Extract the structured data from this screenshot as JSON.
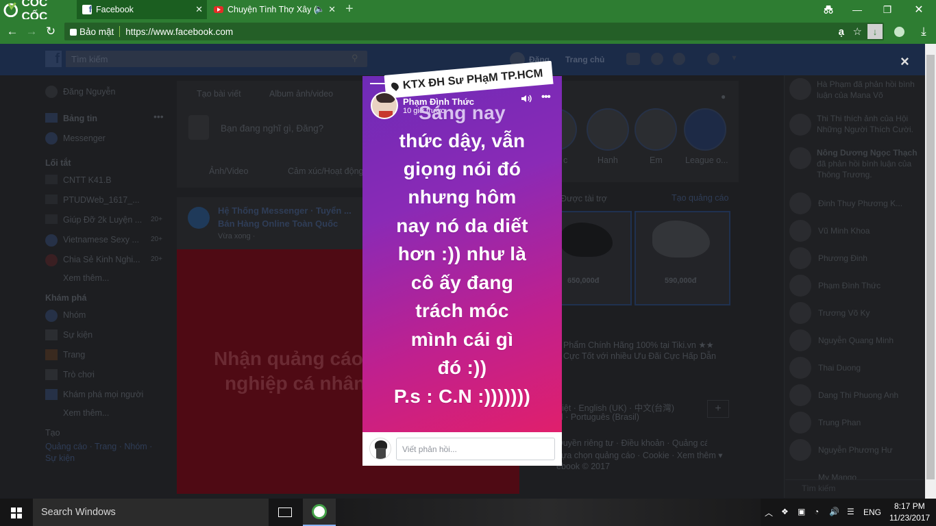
{
  "browser": {
    "brand": "CỐC CỐC",
    "tabs": [
      {
        "title": "Facebook",
        "close": "✕"
      },
      {
        "title": "Chuyện Tình Thợ Xây (",
        "close": "✕"
      }
    ],
    "new_tab": "+",
    "security_label": "Bảo mật",
    "url": "https://www.facebook.com",
    "lang_glyph": "ạ"
  },
  "facebook": {
    "search_placeholder": "Tìm kiếm",
    "header_user": "Đăng",
    "header_home": "Trang chủ",
    "sidebar": {
      "profile": "Đăng Nguyễn",
      "news_feed": "Bảng tin",
      "messenger": "Messenger",
      "shortcuts_heading": "Lối tắt",
      "shortcuts": [
        {
          "label": "CNTT K41.B",
          "count": ""
        },
        {
          "label": "PTUDWeb_1617_...",
          "count": ""
        },
        {
          "label": "Giúp Đỡ 2k Luyện ...",
          "count": "20+"
        },
        {
          "label": "Vietnamese Sexy ...",
          "count": "20+"
        },
        {
          "label": "Chia Sẻ Kinh Nghi...",
          "count": "20+"
        }
      ],
      "see_more": "Xem thêm...",
      "explore_heading": "Khám phá",
      "explore": [
        "Nhóm",
        "Sự kiện",
        "Trang",
        "Trò chơi",
        "Khám phá mọi người"
      ],
      "see_more2": "Xem thêm...",
      "create_heading": "Tạo",
      "create_links": "Quảng cáo · Trang · Nhóm ·",
      "create_links2": "Sự kiện"
    },
    "composer": {
      "create_post": "Tạo bài viết",
      "album": "Album ảnh/video",
      "placeholder": "Bạn đang nghĩ gì, Đăng?",
      "photo_video": "Ảnh/Video",
      "feeling": "Cảm xúc/Hoạt động"
    },
    "post": {
      "author_line1": "Hệ Thống Messenger · Tuyển ...",
      "author_line2": "Bán Hàng Online Toàn Quốc",
      "time": "Vừa xong ·",
      "ad_text_line1": "Nhận quảng cáo",
      "ad_text_line2": "nghiệp cá nhân"
    },
    "stories": [
      {
        "name": "c"
      },
      {
        "name": "Hanh"
      },
      {
        "name": "Em"
      },
      {
        "name": "League o..."
      }
    ],
    "sponsored": {
      "heading": "Được tài trợ",
      "create_ad": "Tạo quảng cáo",
      "prices": [
        "650,000đ",
        "590,000đ"
      ],
      "ad_desc_line1": "Phẩm Chính Hãng 100% tại Tiki.vn ★★",
      "ad_desc_line2": "Cực Tốt với nhiều Ưu Đãi Cực Hấp Dẫn"
    },
    "languages_line1": "Việt · English (UK) · 中文(台灣)",
    "languages_line2": "ol · Português (Brasil)",
    "footer_line1": "Quyền riêng tư · Điều khoản · Quảng cáo",
    "footer_line2": "Lựa chọn quảng cáo · Cookie · Xem thêm ▾",
    "footer_line3": "ebook © 2017",
    "chat": {
      "activity": [
        {
          "line1": "Hà Phạm đã phản hồi bình",
          "line2": "luận của Mana Võ"
        },
        {
          "line1": "Thi Thi thích ảnh của Hội",
          "line2": "Những Người Thích Cười."
        },
        {
          "line1": "Nông Dương Ngọc Thạch",
          "line2": "đã phản hồi bình luận của",
          "line3": "Thông Trương."
        }
      ],
      "contacts": [
        "Đinh Thuy Phương K...",
        "Vũ Minh Khoa",
        "Phương Đinh",
        "Phạm Đình Thức",
        "Trương Võ Ky",
        "Nguyễn Quang Minh",
        "Thai Duong",
        "Dang Thi Phuong Anh",
        "Trung Phan",
        "Nguyễn Phương Hư",
        "My Mango"
      ],
      "search_placeholder": "Tìm kiếm"
    }
  },
  "story": {
    "location_sticker": "KTX ĐH Sư PHạM TP.HCM",
    "author": "Phạm Đình Thức",
    "time": "10 giờ trước",
    "lines": [
      "Sáng nay",
      "thức dậy, vẫn",
      "giọng nói đó",
      "nhưng hôm",
      "nay nó da diết",
      "hơn :)) như là",
      "cô ấy đang",
      "trách móc",
      "mình cái gì",
      "đó :))",
      "P.s : C.N :)))))))"
    ],
    "progress": 0.5,
    "reply_placeholder": "Viết phản hồi...",
    "close": "×"
  },
  "taskbar": {
    "search_placeholder": "Search Windows",
    "language": "ENG",
    "time": "8:17 PM",
    "date": "11/23/2017"
  }
}
